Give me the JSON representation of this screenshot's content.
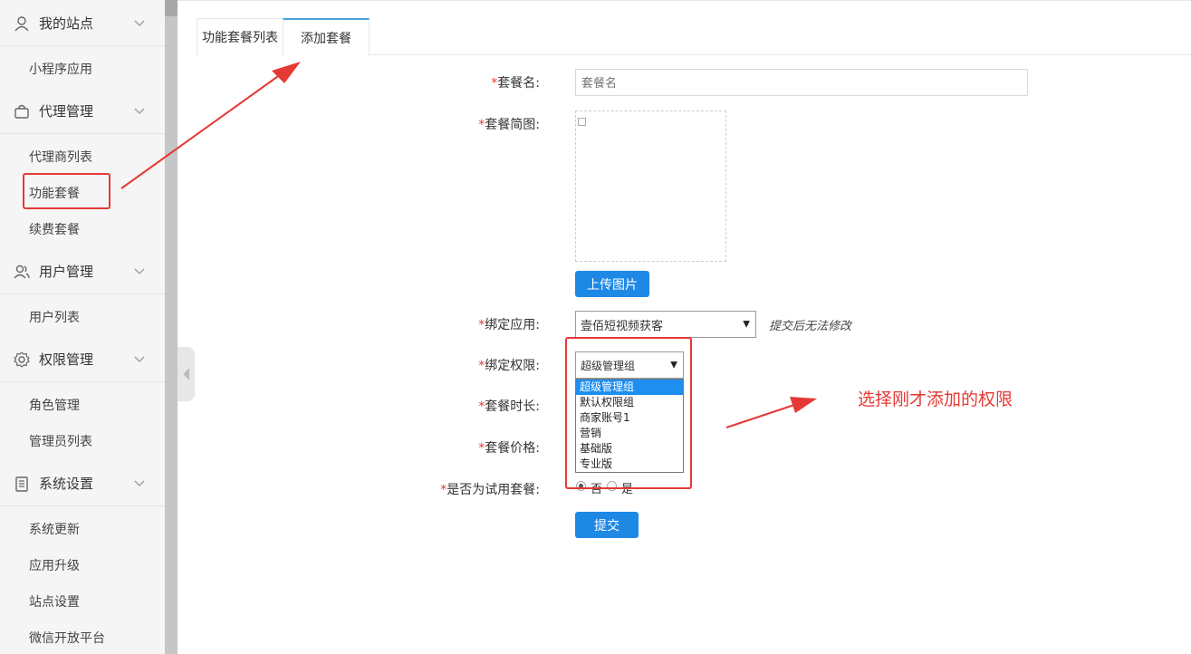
{
  "sidebar": {
    "groups": [
      {
        "label": "我的站点",
        "icon": "user-location-icon",
        "items": [
          "小程序应用"
        ]
      },
      {
        "label": "代理管理",
        "icon": "bag-icon",
        "items": [
          "代理商列表",
          "功能套餐",
          "续费套餐"
        ]
      },
      {
        "label": "用户管理",
        "icon": "users-icon",
        "items": [
          "用户列表"
        ]
      },
      {
        "label": "权限管理",
        "icon": "gear-icon",
        "items": [
          "角色管理",
          "管理员列表"
        ]
      },
      {
        "label": "系统设置",
        "icon": "clipboard-icon",
        "items": [
          "系统更新",
          "应用升级",
          "站点设置",
          "微信开放平台"
        ]
      }
    ]
  },
  "tabs": [
    "功能套餐列表",
    "添加套餐"
  ],
  "form": {
    "name_label": "套餐名:",
    "name_placeholder": "套餐名",
    "image_label": "套餐简图:",
    "upload_button": "上传图片",
    "app_label": "绑定应用:",
    "app_value": "壹佰短视频获客",
    "app_hint": "提交后无法修改",
    "perm_label": "绑定权限:",
    "perm_value": "超级管理组",
    "perm_options": [
      "超级管理组",
      "默认权限组",
      "商家账号1",
      "营销",
      "基础版",
      "专业版"
    ],
    "duration_label": "套餐时长:",
    "price_label": "套餐价格:",
    "trial_label": "是否为试用套餐:",
    "trial_no": "否",
    "trial_yes": "是",
    "submit_button": "提交"
  },
  "annotation": {
    "text": "选择刚才添加的权限",
    "color": "#e53935"
  },
  "colors": {
    "primary": "#1e88e5",
    "required": "#e53935",
    "selected_option": "#1e8ef0"
  }
}
